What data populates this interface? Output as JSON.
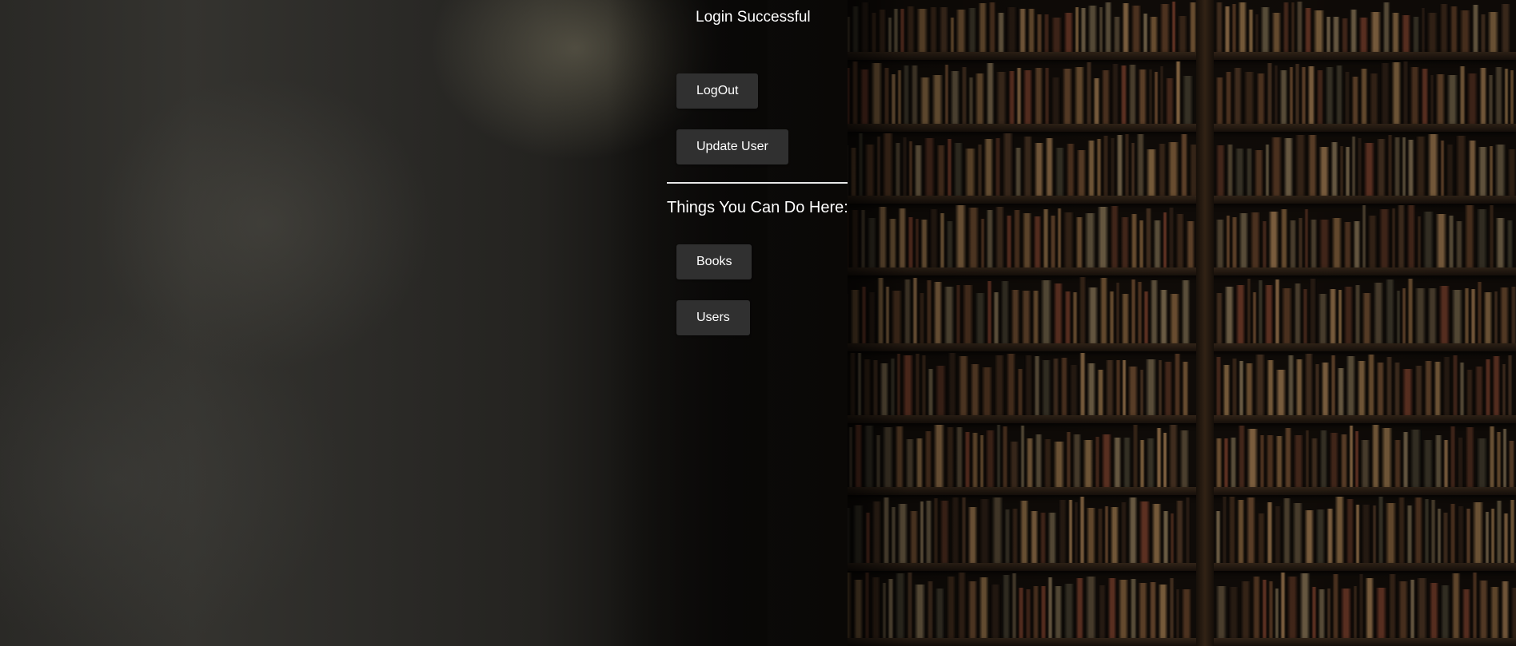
{
  "header": {
    "title": "Login Successful"
  },
  "account_actions": {
    "logout_label": "LogOut",
    "update_user_label": "Update User"
  },
  "section": {
    "heading": "Things You Can Do Here:",
    "items": [
      {
        "label": "Books"
      },
      {
        "label": "Users"
      }
    ]
  },
  "colors": {
    "button_bg": "#303030",
    "text": "#ffffff",
    "divider": "#e8e8e8"
  }
}
